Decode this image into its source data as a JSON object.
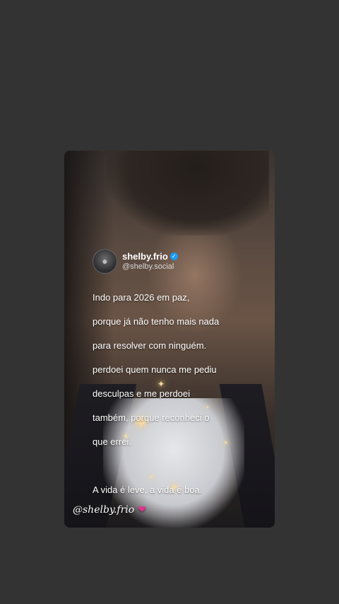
{
  "tweet": {
    "display_name": "shelby.frio",
    "handle": "@shelby.social",
    "verified_icon": "verified-badge-icon",
    "lines": [
      "Indo para 2026 em paz,",
      "porque já não tenho mais nada",
      "para resolver com ninguém.",
      "perdoei quem nunca me pediu",
      "desculpas e me perdoei",
      "também, porque reconheci o",
      "que errei."
    ],
    "closing": "A vida é leve, a vida é boa."
  },
  "watermark": {
    "text": "@shelby.frio",
    "icon": "broken-heart-icon"
  },
  "colors": {
    "background": "#333333",
    "verified": "#1d9bf0",
    "heart": "#e0338f"
  }
}
